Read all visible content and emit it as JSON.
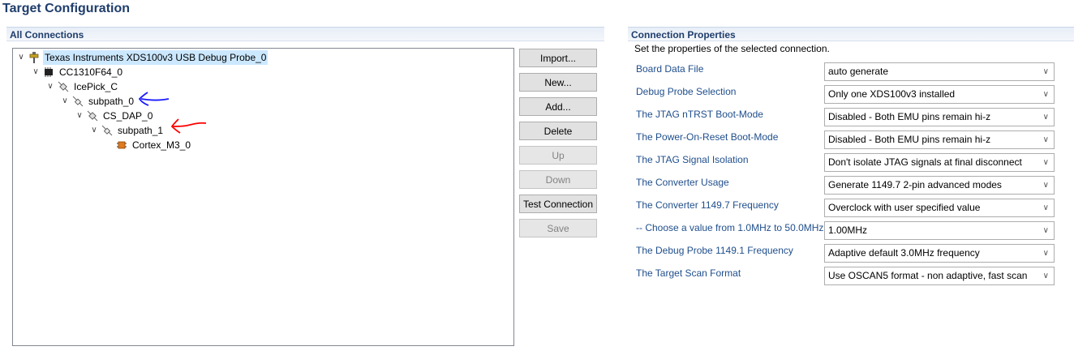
{
  "title": "Target Configuration",
  "left_section": {
    "header": "All Connections",
    "tree": [
      {
        "label": "Texas Instruments XDS100v3 USB Debug Probe_0",
        "icon": "debug-probe-icon",
        "expanded": true,
        "selected": true
      },
      {
        "label": "CC1310F64_0",
        "icon": "chip-icon",
        "expanded": true
      },
      {
        "label": "IcePick_C",
        "icon": "router-icon",
        "expanded": true
      },
      {
        "label": "subpath_0",
        "icon": "subpath-icon",
        "expanded": true
      },
      {
        "label": "CS_DAP_0",
        "icon": "router-icon",
        "expanded": true
      },
      {
        "label": "subpath_1",
        "icon": "subpath-icon",
        "expanded": true
      },
      {
        "label": "Cortex_M3_0",
        "icon": "cpu-core-icon",
        "expanded": false
      }
    ],
    "buttons": [
      {
        "label": "Import...",
        "enabled": true
      },
      {
        "label": "New...",
        "enabled": true
      },
      {
        "label": "Add...",
        "enabled": true
      },
      {
        "label": "Delete",
        "enabled": true
      },
      {
        "label": "Up",
        "enabled": false
      },
      {
        "label": "Down",
        "enabled": false
      },
      {
        "label": "Test Connection",
        "enabled": true
      },
      {
        "label": "Save",
        "enabled": false
      }
    ]
  },
  "right_section": {
    "header": "Connection Properties",
    "description": "Set the properties of the selected connection.",
    "properties": [
      {
        "label": "Board Data File",
        "value": "auto generate"
      },
      {
        "label": "Debug Probe Selection",
        "value": "Only one XDS100v3 installed"
      },
      {
        "label": "The JTAG nTRST Boot-Mode",
        "value": "Disabled - Both EMU pins remain hi-z"
      },
      {
        "label": "The Power-On-Reset Boot-Mode",
        "value": "Disabled - Both EMU pins remain hi-z"
      },
      {
        "label": "The JTAG Signal Isolation",
        "value": "Don't isolate JTAG signals at final disconnect"
      },
      {
        "label": "The Converter Usage",
        "value": "Generate 1149.7 2-pin advanced modes"
      },
      {
        "label": "The Converter 1149.7 Frequency",
        "value": "Overclock with user specified value"
      },
      {
        "label": "-- Choose a value from 1.0MHz to 50.0MHz",
        "value": "1.00MHz"
      },
      {
        "label": "The Debug Probe 1149.1 Frequency",
        "value": "Adaptive default 3.0MHz frequency"
      },
      {
        "label": "The Target Scan Format",
        "value": "Use OSCAN5 format - non adaptive, fast scan"
      }
    ]
  },
  "annotations": {
    "blue_arrow_color": "#1a1aff",
    "red_arrow_color": "#ff0000"
  }
}
